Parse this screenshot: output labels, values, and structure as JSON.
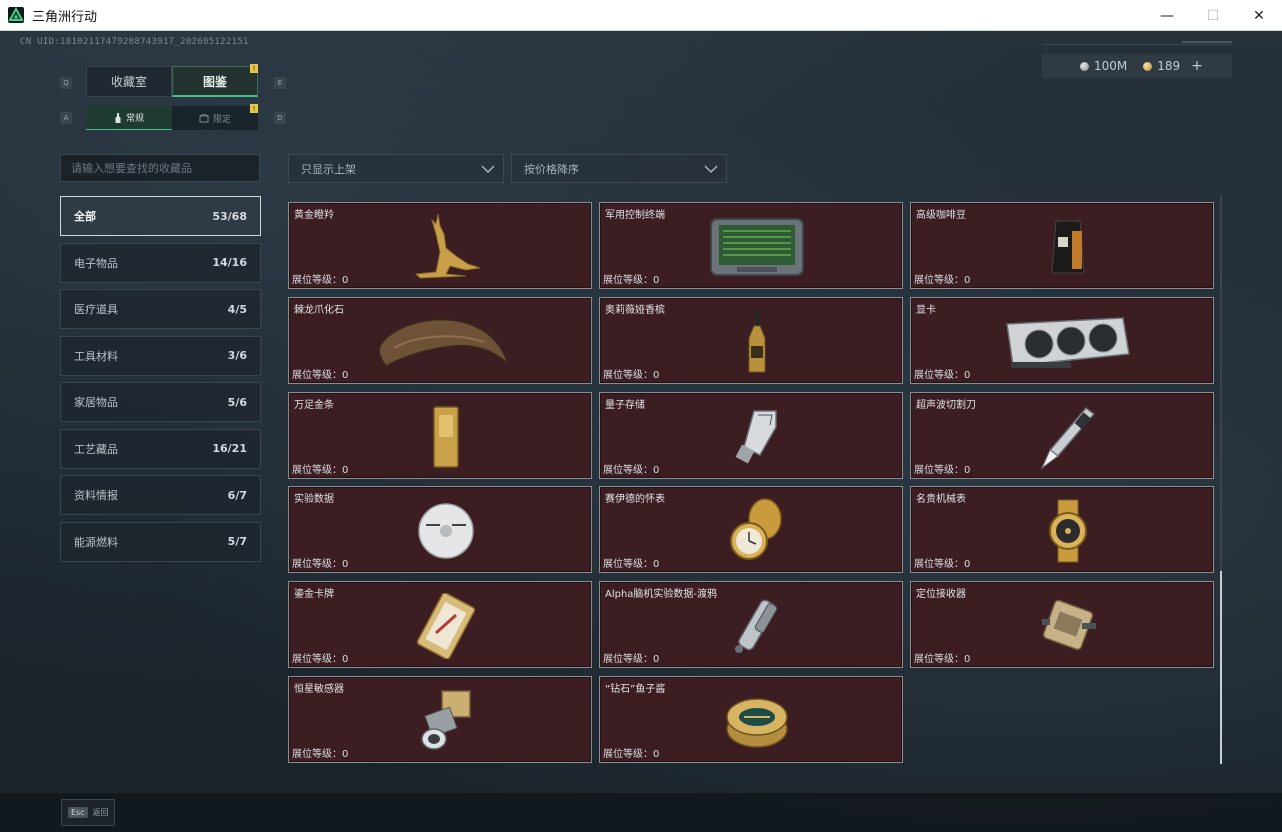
{
  "window": {
    "title": "三角洲行动",
    "minimize": "—",
    "maximize": "☐",
    "close": "✕"
  },
  "uid": "CN UID:18102117479288743917_202605122151",
  "currency": {
    "money": "100M",
    "coins": "189",
    "add": "+"
  },
  "keys": {
    "prev_tab": "Q",
    "next_tab": "E",
    "prev_sub": "A",
    "next_sub": "D"
  },
  "main_tabs": [
    {
      "label": "收藏室"
    },
    {
      "label": "图鉴"
    }
  ],
  "sub_tabs": [
    {
      "label": "常规"
    },
    {
      "label": "限定"
    }
  ],
  "search": {
    "placeholder": "请输入想要查找的收藏品"
  },
  "categories": [
    {
      "name": "全部",
      "count": "53/68"
    },
    {
      "name": "电子物品",
      "count": "14/16"
    },
    {
      "name": "医疗道具",
      "count": "4/5"
    },
    {
      "name": "工具材料",
      "count": "3/6"
    },
    {
      "name": "家居物品",
      "count": "5/6"
    },
    {
      "name": "工艺藏品",
      "count": "16/21"
    },
    {
      "name": "资料情报",
      "count": "6/7"
    },
    {
      "name": "能源燃料",
      "count": "5/7"
    }
  ],
  "filters": {
    "shelf": "只显示上架",
    "sort": "按价格降序"
  },
  "items": [
    {
      "name": "黄金瞪羚",
      "level": "展位等级：0",
      "icon": "gazelle-icon"
    },
    {
      "name": "军用控制终端",
      "level": "展位等级：0",
      "icon": "terminal-icon"
    },
    {
      "name": "高级咖啡豆",
      "level": "展位等级：0",
      "icon": "coffee-bag-icon"
    },
    {
      "name": "棘龙爪化石",
      "level": "展位等级：0",
      "icon": "claw-fossil-icon"
    },
    {
      "name": "奥莉薇娅香槟",
      "level": "展位等级：0",
      "icon": "champagne-icon"
    },
    {
      "name": "显卡",
      "level": "展位等级：0",
      "icon": "gpu-icon"
    },
    {
      "name": "万足金条",
      "level": "展位等级：0",
      "icon": "gold-bar-icon"
    },
    {
      "name": "量子存储",
      "level": "展位等级：0",
      "icon": "usb-drive-icon"
    },
    {
      "name": "超声波切割刀",
      "level": "展位等级：0",
      "icon": "ultrasonic-knife-icon"
    },
    {
      "name": "实验数据",
      "level": "展位等级：0",
      "icon": "disc-icon"
    },
    {
      "name": "赛伊德的怀表",
      "level": "展位等级：0",
      "icon": "pocket-watch-icon"
    },
    {
      "name": "名贵机械表",
      "level": "展位等级：0",
      "icon": "wristwatch-icon"
    },
    {
      "name": "鎏金卡牌",
      "level": "展位等级：0",
      "icon": "gilded-card-icon"
    },
    {
      "name": "Alpha脑机实验数据-渡鸦",
      "level": "展位等级：0",
      "icon": "data-cylinder-icon"
    },
    {
      "name": "定位接收器",
      "level": "展位等级：0",
      "icon": "receiver-icon"
    },
    {
      "name": "恒星敏感器",
      "level": "展位等级：0",
      "icon": "star-sensor-icon"
    },
    {
      "name": "“钻石”鱼子酱",
      "level": "展位等级：0",
      "icon": "caviar-tin-icon"
    }
  ],
  "footer": {
    "esc_key": "Esc",
    "esc_label": "返回"
  },
  "colors": {
    "card_bg": "#3b1d22",
    "accent_green": "#3fc28b",
    "badge_yellow": "#e7c64a"
  }
}
